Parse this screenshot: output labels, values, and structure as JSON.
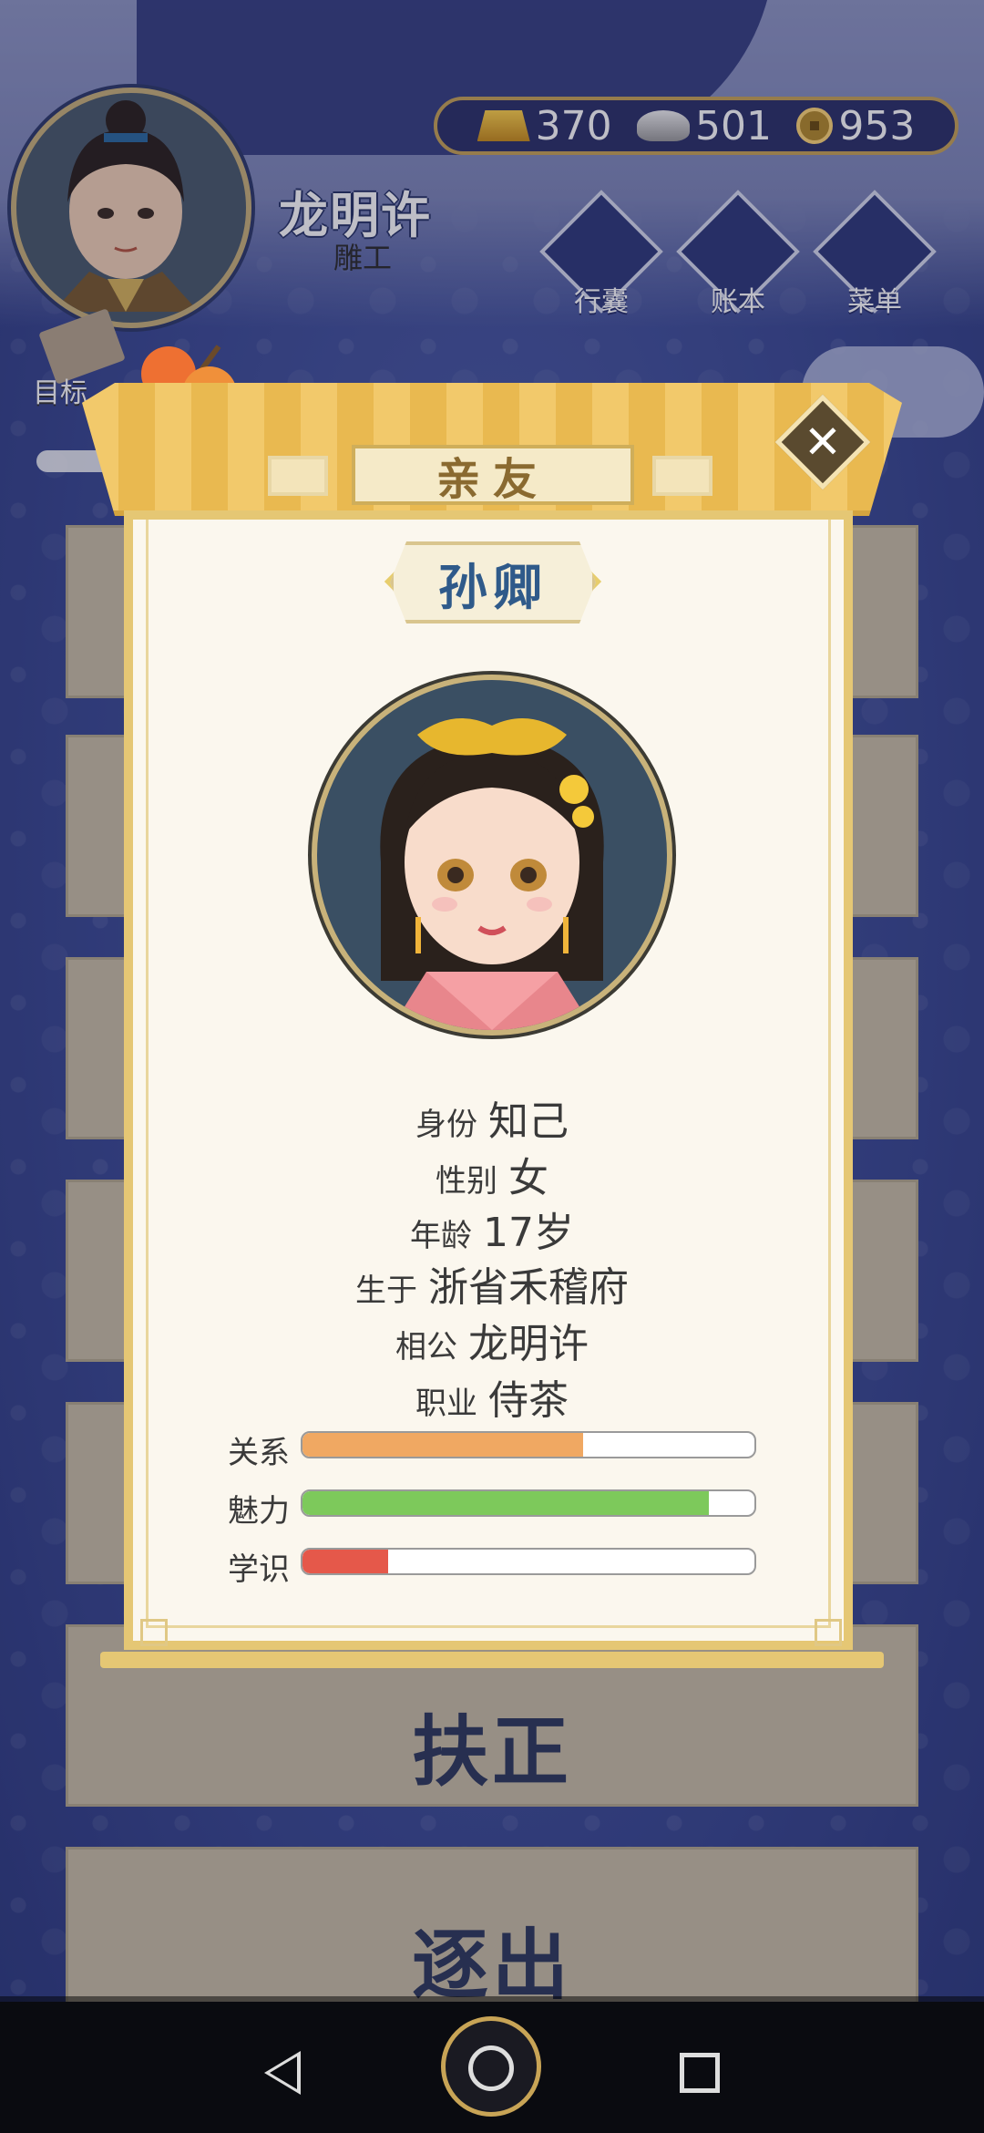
{
  "player": {
    "name": "龙明许",
    "job": "雕工"
  },
  "currency": {
    "gold": "370",
    "silver": "501",
    "copper": "953"
  },
  "top_buttons": [
    {
      "label": "行囊",
      "icon": "bag-icon"
    },
    {
      "label": "账本",
      "icon": "ledger-icon"
    },
    {
      "label": "菜单",
      "icon": "menu-dots-icon"
    }
  ],
  "goal": {
    "label": "目标"
  },
  "background_actions": {
    "fuzheng": "扶正",
    "zhuchu": "逐出"
  },
  "modal": {
    "title": "亲友",
    "person_name": "孙卿",
    "info": [
      {
        "key": "身份",
        "value": "知己"
      },
      {
        "key": "性别",
        "value": "女"
      },
      {
        "key": "年龄",
        "value": "17岁"
      },
      {
        "key": "生于",
        "value": "浙省禾稽府"
      },
      {
        "key": "相公",
        "value": "龙明许"
      },
      {
        "key": "职业",
        "value": "侍茶"
      }
    ],
    "stats": [
      {
        "label": "关系",
        "fraction": 0.62,
        "color": "#f0a862"
      },
      {
        "label": "魅力",
        "fraction": 0.9,
        "color": "#7dc95b"
      },
      {
        "label": "学识",
        "fraction": 0.19,
        "color": "#e5584a"
      }
    ]
  },
  "colors": {
    "accent_gold": "#e5c774",
    "name_blue": "#2f5a8a",
    "bg_blue": "#3b4a94"
  }
}
